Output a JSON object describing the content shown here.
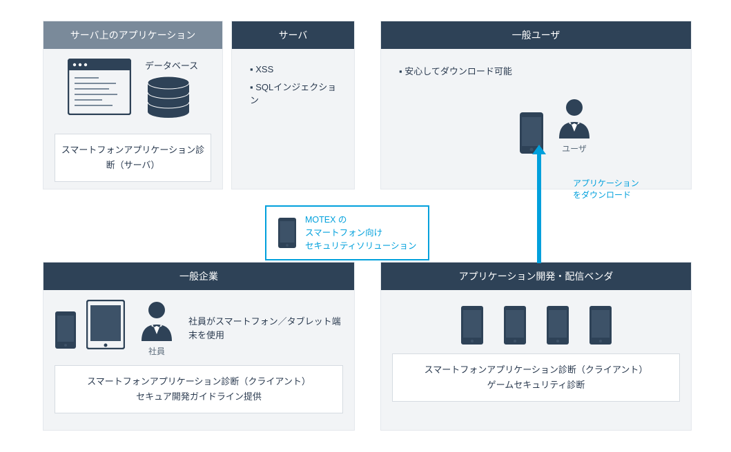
{
  "panels": {
    "serverApp": {
      "title": "サーバ上のアプリケーション",
      "dbLabel": "データベース",
      "subBox": "スマートフォンアプリケーション診断（サーバ）"
    },
    "server": {
      "title": "サーバ",
      "bullets": [
        "XSS",
        "SQLインジェクション"
      ]
    },
    "generalUser": {
      "title": "一般ユーザ",
      "bullet": "安心してダウンロード可能",
      "userLabel": "ユーザ"
    },
    "enterprise": {
      "title": "一般企業",
      "employeeLabel": "社員",
      "note": "社員がスマートフォン／タブレット端末を使用",
      "subBox1": "スマートフォンアプリケーション診断（クライアント）",
      "subBox2": "セキュア開発ガイドライン提供"
    },
    "vendor": {
      "title": "アプリケーション開発・配信ベンダ",
      "subBox1": "スマートフォンアプリケーション診断（クライアント）",
      "subBox2": "ゲームセキュリティ診断"
    }
  },
  "callout": {
    "line1": "MOTEX の",
    "line2": "スマートフォン向け",
    "line3": "セキュリティソリューション"
  },
  "arrowLabel": {
    "line1": "アプリケーション",
    "line2": "をダウンロード"
  }
}
